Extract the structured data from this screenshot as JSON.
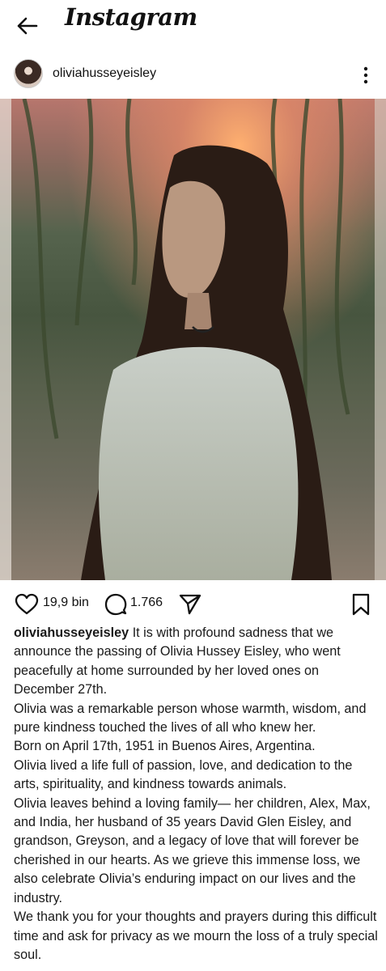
{
  "app": {
    "title": "Instagram"
  },
  "post": {
    "username": "oliviahusseyeisley",
    "likes": "19,9 bin",
    "comments": "1.766",
    "caption_user": "oliviahusseyeisley",
    "caption_lines": [
      "It is with profound sadness that we announce the passing of Olivia Hussey Eisley, who went peacefully at home surrounded by her loved ones on December 27th.",
      "Olivia was a remarkable person whose warmth, wisdom, and pure kindness touched the lives of all who knew her.",
      "Born on April 17th, 1951 in Buenos Aires, Argentina.",
      "Olivia lived a life full of passion, love, and dedication to the arts, spirituality, and kindness towards animals.",
      "Olivia leaves behind a loving family— her children, Alex, Max, and India, her husband of 35 years David Glen Eisley, and grandson, Greyson, and a legacy of love that will forever be cherished in our hearts. As we grieve this immense loss, we also celebrate Olivia’s enduring impact on our lives and the industry.",
      "We thank you for your thoughts and prayers during this difficult time and ask for privacy as we mourn the loss of a truly special soul."
    ]
  },
  "icons": {
    "back": "arrow-left-icon",
    "more": "more-vertical-icon",
    "like": "heart-icon",
    "comment": "comment-icon",
    "share": "send-icon",
    "save": "bookmark-icon"
  }
}
